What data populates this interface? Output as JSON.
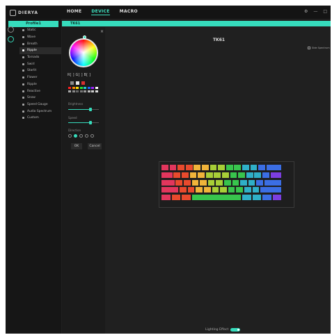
{
  "titlebar": {
    "brand": "DIERYA"
  },
  "nav": {
    "home": "HOME",
    "device": "DEVICE",
    "macro": "MACRO"
  },
  "window_controls": {
    "settings": "⚙",
    "minimize": "—",
    "close": "□"
  },
  "profile_label": "Profile1",
  "device_tab": "TK61",
  "menu": {
    "items": [
      {
        "label": "Static"
      },
      {
        "label": "Wave"
      },
      {
        "label": "Breath"
      },
      {
        "label": "Ripple"
      },
      {
        "label": "Tornado"
      },
      {
        "label": "Swirl"
      },
      {
        "label": "Starlit"
      },
      {
        "label": "Flower"
      },
      {
        "label": "Ripple"
      },
      {
        "label": "Reactive"
      },
      {
        "label": "Snow"
      },
      {
        "label": "Speed Gauge"
      },
      {
        "label": "Audio Spectrum"
      },
      {
        "label": "Custom"
      }
    ]
  },
  "color_panel": {
    "rgb_text": "R[  ] G[  ] B[  ]",
    "brightness_label": "Brightness",
    "brightness_value": 0.72,
    "speed_label": "Speed",
    "speed_value": 0.72,
    "direction_label": "Direction",
    "ok_label": "OK",
    "cancel_label": "Cancel"
  },
  "keyboard_title": "TK61",
  "side_setting": "Side Spectrum",
  "lighting_effect_label": "Lighting Effect",
  "palette_colors": [
    "#ff2020",
    "#ff8a00",
    "#ffe000",
    "#29e030",
    "#20d0d0",
    "#2060ff",
    "#a020ff",
    "#ffffff",
    "#aaaaaa",
    "#888888",
    "#666666",
    "#777777",
    "#999999",
    "#bbbbbb",
    "#cccccc",
    "#dddddd"
  ],
  "key_colors": [
    "#e2365d",
    "#e94a2d",
    "#f1b43a",
    "#a8cf37",
    "#38c54d",
    "#2fb0c8",
    "#3b6ee4",
    "#7c3ee0"
  ]
}
